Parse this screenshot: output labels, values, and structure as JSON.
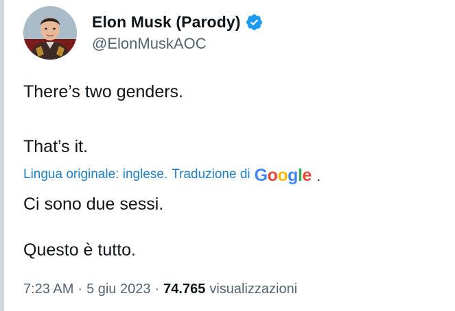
{
  "author": {
    "display_name": "Elon Musk (Parody)",
    "handle": "@ElonMuskAOC",
    "verified": true,
    "avatar_icon": "profile-photo"
  },
  "tweet": {
    "line1": "There’s two genders.",
    "line2": "That’s it."
  },
  "translation": {
    "source_label": "Lingua originale: inglese.",
    "by_label": "Traduzione di",
    "provider": "Google",
    "trailing": ".",
    "line1": "Ci sono due sessi.",
    "line2": "Questo è tutto."
  },
  "meta": {
    "time": "7:23 AM",
    "separator": "·",
    "date": "5 giu 2023",
    "views_count": "74.765",
    "views_label": "visualizzazioni"
  },
  "colors": {
    "verified_badge": "#1d9bf0",
    "link": "#1d7fc4",
    "secondary_text": "#536471",
    "primary_text": "#0f1419"
  }
}
